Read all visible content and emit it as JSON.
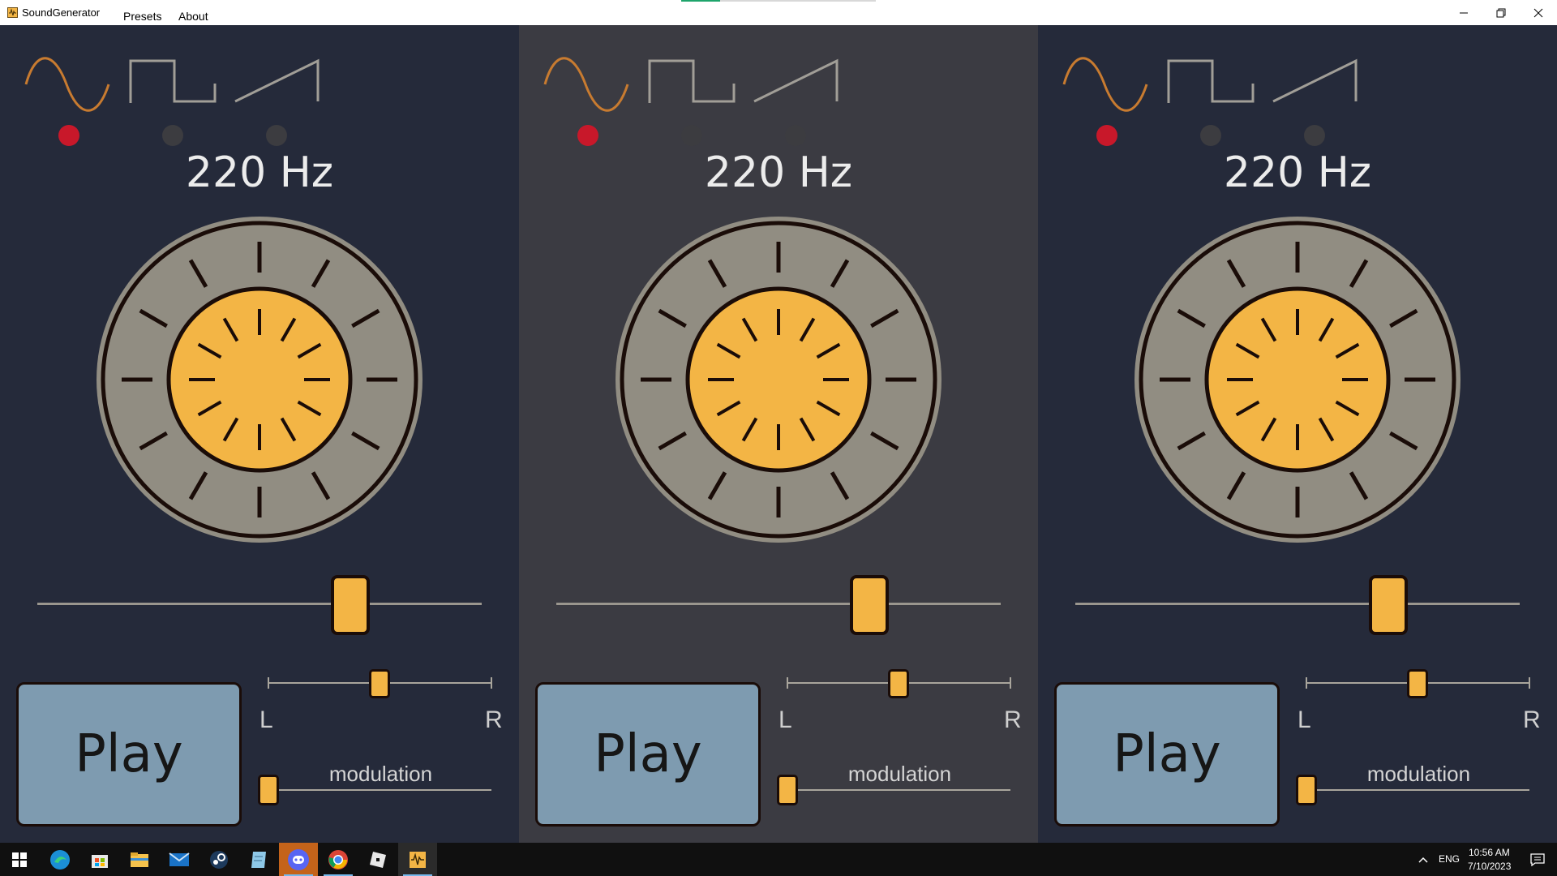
{
  "window": {
    "title": "SoundGenerator",
    "menu": [
      "Presets",
      "About"
    ],
    "controls": {
      "minimize_icon": "minimize-icon",
      "restore_icon": "restore-icon",
      "close_icon": "close-icon"
    }
  },
  "colors": {
    "panel_bg_dark": "#252a3a",
    "panel_bg_gray": "#3b3b42",
    "accent_orange": "#f3b545",
    "wave_icon": "#c87b30",
    "radio_selected": "#c8182a",
    "radio_unselected": "#3c3c40",
    "knob_ring": "#918d82",
    "play_button": "#7e9bb0"
  },
  "panels": [
    {
      "waveforms": [
        "sine",
        "square",
        "sawtooth"
      ],
      "selected_waveform": "sine",
      "frequency": "220 Hz",
      "frequency_slider": 0.7,
      "play_label": "Play",
      "pan": {
        "left_label": "L",
        "right_label": "R",
        "value": 0.5
      },
      "modulation": {
        "label": "modulation",
        "value": 0.0
      }
    },
    {
      "waveforms": [
        "sine",
        "square",
        "sawtooth"
      ],
      "selected_waveform": "sine",
      "frequency": "220 Hz",
      "frequency_slider": 0.7,
      "play_label": "Play",
      "pan": {
        "left_label": "L",
        "right_label": "R",
        "value": 0.5
      },
      "modulation": {
        "label": "modulation",
        "value": 0.0
      }
    },
    {
      "waveforms": [
        "sine",
        "square",
        "sawtooth"
      ],
      "selected_waveform": "sine",
      "frequency": "220 Hz",
      "frequency_slider": 0.7,
      "play_label": "Play",
      "pan": {
        "left_label": "L",
        "right_label": "R",
        "value": 0.5
      },
      "modulation": {
        "label": "modulation",
        "value": 0.0
      }
    }
  ],
  "taskbar": {
    "apps": [
      "windows-start-icon",
      "edge-icon",
      "store-icon",
      "file-explorer-icon",
      "mail-icon",
      "steam-icon",
      "notepad-icon",
      "discord-icon",
      "chrome-icon",
      "roblox-icon",
      "soundgenerator-icon"
    ],
    "tray": {
      "chevron_icon": "chevron-up-icon",
      "language": "ENG",
      "notification_icon": "notification-icon"
    },
    "clock": {
      "time": "10:56 AM",
      "date": "7/10/2023"
    }
  }
}
